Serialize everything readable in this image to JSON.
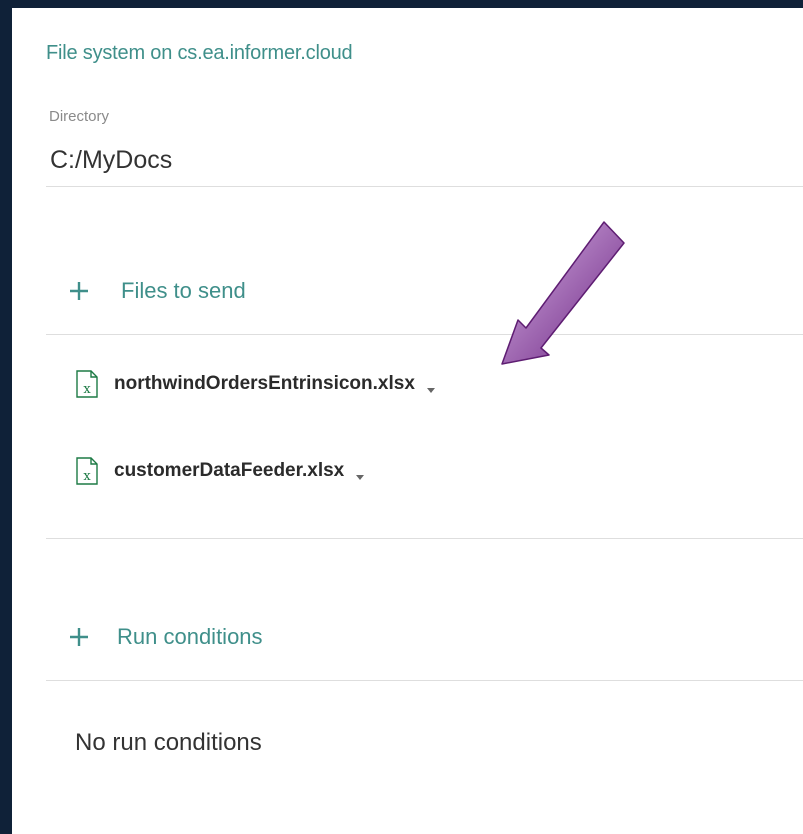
{
  "panel": {
    "title": "File system on cs.ea.informer.cloud",
    "directory": {
      "label": "Directory",
      "value": "C:/MyDocs"
    }
  },
  "files_section": {
    "header_label": "Files to send",
    "header_icon": "plus-icon",
    "files": [
      {
        "name": "northwindOrdersEntrinsicon.xlsx",
        "icon": "xlsx-file-icon"
      },
      {
        "name": "customerDataFeeder.xlsx",
        "icon": "xlsx-file-icon"
      }
    ]
  },
  "conditions_section": {
    "header_label": "Run conditions",
    "header_icon": "plus-icon",
    "empty_text": "No run conditions"
  },
  "colors": {
    "background": "#0f2138",
    "accent": "#3f8f8a",
    "excel_green": "#1d7a45",
    "arrow_purple": "#7a2f8c"
  }
}
